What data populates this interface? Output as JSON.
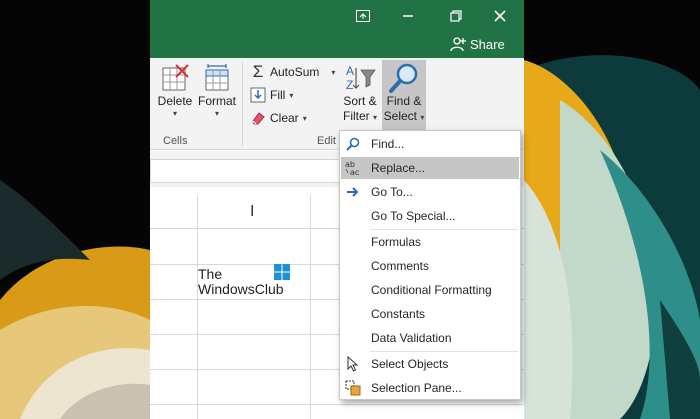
{
  "titlebar": {
    "share_label": "Share"
  },
  "ribbon": {
    "cells_group": {
      "label": "Cells",
      "delete_label": "Delete",
      "format_label": "Format"
    },
    "editing_group": {
      "label": "Edit",
      "autosum_label": "AutoSum",
      "fill_label": "Fill",
      "clear_label": "Clear",
      "sort_filter_line1": "Sort &",
      "sort_filter_line2": "Filter",
      "find_select_line1": "Find &",
      "find_select_line2": "Select"
    }
  },
  "sheet": {
    "column_name": "I"
  },
  "watermark": {
    "line1": "The",
    "line2": "WindowsClub"
  },
  "find_select_menu": {
    "items": [
      {
        "label": "Find...",
        "icon": "magnifier-icon"
      },
      {
        "label": "Replace...",
        "icon": "replace-abc-icon",
        "highlighted": true
      },
      {
        "label": "Go To...",
        "icon": "arrow-right-icon"
      },
      {
        "label": "Go To Special...",
        "icon": ""
      },
      {
        "label": "Formulas",
        "icon": ""
      },
      {
        "label": "Comments",
        "icon": ""
      },
      {
        "label": "Conditional Formatting",
        "icon": ""
      },
      {
        "label": "Constants",
        "icon": ""
      },
      {
        "label": "Data Validation",
        "icon": ""
      },
      {
        "label": "Select Objects",
        "icon": "pointer-icon"
      },
      {
        "label": "Selection Pane...",
        "icon": "selection-pane-icon"
      }
    ]
  },
  "colors": {
    "excel_green": "#217346",
    "highlight_gray": "#c6c6c6",
    "icon_blue": "#2b6cb3"
  }
}
